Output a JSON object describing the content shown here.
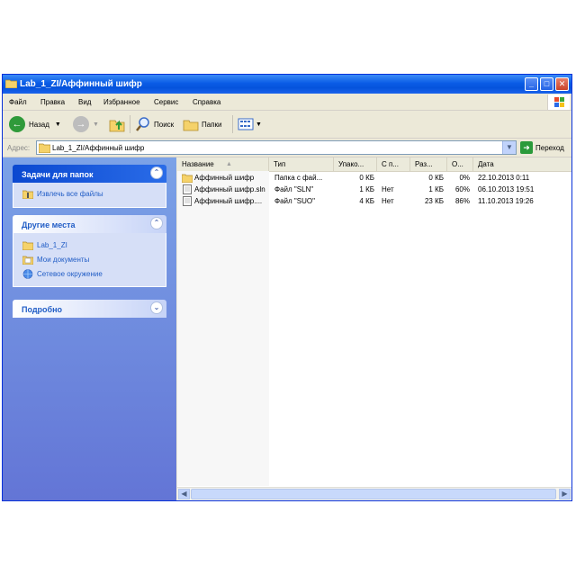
{
  "window": {
    "title": "Lab_1_ZI/Аффинный шифр",
    "controls": {
      "minimize": "_",
      "maximize": "□",
      "close": "✕"
    }
  },
  "menu": [
    "Файл",
    "Правка",
    "Вид",
    "Избранное",
    "Сервис",
    "Справка"
  ],
  "toolbar": {
    "back_label": "Назад",
    "search_label": "Поиск",
    "folders_label": "Папки"
  },
  "address": {
    "label": "Адрес:",
    "value": "Lab_1_ZI/Аффинный шифр",
    "go_label": "Переход"
  },
  "sidebar": {
    "tasks": {
      "title": "Задачи для папок",
      "items": [
        "Извлечь все файлы"
      ]
    },
    "places": {
      "title": "Другие места",
      "items": [
        "Lab_1_ZI",
        "Мои документы",
        "Сетевое окружение"
      ]
    },
    "details": {
      "title": "Подробно"
    }
  },
  "columns": [
    "Название",
    "Тип",
    "Упако...",
    "С п...",
    "Раз...",
    "О...",
    "Дата"
  ],
  "files": [
    {
      "name": "Аффинный шифр",
      "type": "Папка с фай...",
      "packed": "0 КБ",
      "pwd": "",
      "size": "0 КБ",
      "ratio": "0%",
      "date": "22.10.2013 0:11",
      "icon": "folder-icon"
    },
    {
      "name": "Аффинный шифр.sln",
      "type": "Файл \"SLN\"",
      "packed": "1 КБ",
      "pwd": "Нет",
      "size": "1 КБ",
      "ratio": "60%",
      "date": "06.10.2013 19:51",
      "icon": "file-icon"
    },
    {
      "name": "Аффинный шифр....",
      "type": "Файл \"SUO\"",
      "packed": "4 КБ",
      "pwd": "Нет",
      "size": "23 КБ",
      "ratio": "86%",
      "date": "11.10.2013 19:26",
      "icon": "file-icon"
    }
  ]
}
